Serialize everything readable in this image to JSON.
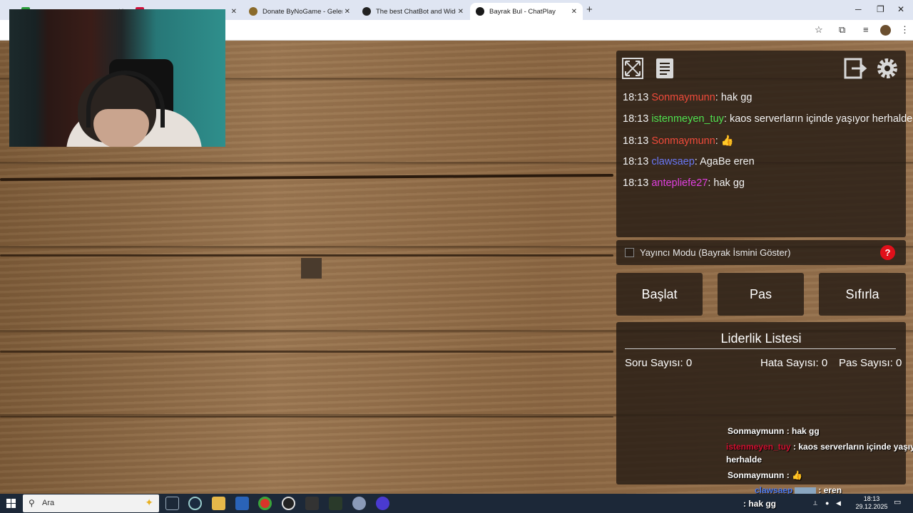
{
  "browser": {
    "tabs": [
      {
        "title": "",
        "color": "#2a9d3a"
      },
      {
        "title": "",
        "color": "#d0103a"
      },
      {
        "title": "Donate ByNoGame - Gelen/Gid",
        "color": "#333333"
      },
      {
        "title": "The best ChatBot and Widgets",
        "color": "#222222"
      },
      {
        "title": "Bayrak Bul - ChatPlay",
        "color": "#1a1a1a"
      }
    ],
    "new_tab": "+",
    "close": "✕"
  },
  "chat": {
    "messages": [
      {
        "time": "18:13",
        "user": "Sonmaymunn",
        "color": "#f04a3a",
        "text": "hak gg"
      },
      {
        "time": "18:13",
        "user": "istenmeyen_tuy",
        "color": "#4fe04f",
        "text": "kaos serverların içinde yaşıyor herhalde"
      },
      {
        "time": "18:13",
        "user": "Sonmaymunn",
        "color": "#f04a3a",
        "text": "👍"
      },
      {
        "time": "18:13",
        "user": "clawsaep",
        "color": "#6a78f5",
        "text": "AgaBe eren"
      },
      {
        "time": "18:13",
        "user": "antepliefe27",
        "color": "#e040e0",
        "text": "hak gg"
      }
    ]
  },
  "mode": {
    "label": "Yayıncı Modu (Bayrak İsmini Göster)",
    "help": "?"
  },
  "buttons": {
    "start": "Başlat",
    "pass": "Pas",
    "reset": "Sıfırla"
  },
  "leaderboard": {
    "title": "Liderlik Listesi",
    "questions": "Soru Sayısı: 0",
    "errors": "Hata Sayısı: 0",
    "passes": "Pas Sayısı: 0"
  },
  "overlay": {
    "l1_user": "Sonmaymunn",
    "l1_text": ": hak gg",
    "l2_user": "istenmeyen_tuy",
    "l2_text": ": kaos serverların içinde yaşıyor",
    "l2_cont": "herhalde",
    "l3_user": "Sonmaymunn",
    "l3_text": ": 👍",
    "l4_user": "clawsaep",
    "l4_text": ": eren",
    "l5_text": ": hak gg"
  },
  "taskbar": {
    "search_placeholder": "Ara",
    "time": "18:13",
    "date": "29.12.2025"
  }
}
